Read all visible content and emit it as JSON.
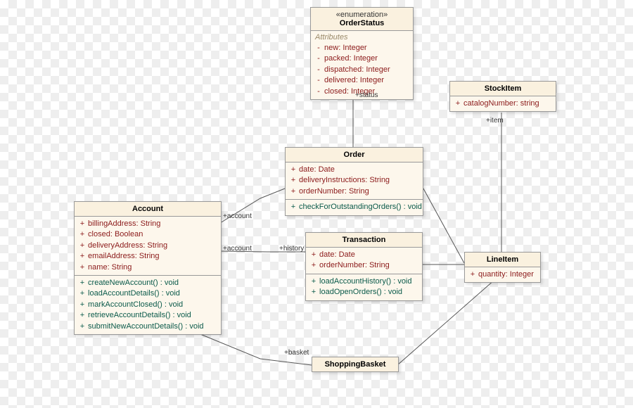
{
  "classes": {
    "orderStatus": {
      "stereotype": "«enumeration»",
      "name": "OrderStatus",
      "attrHeader": "Attributes",
      "attrs": [
        {
          "vis": "-",
          "text": "new: Integer"
        },
        {
          "vis": "-",
          "text": "packed: Integer"
        },
        {
          "vis": "-",
          "text": "dispatched: Integer"
        },
        {
          "vis": "-",
          "text": "delivered: Integer"
        },
        {
          "vis": "-",
          "text": "closed: Integer"
        }
      ]
    },
    "stockItem": {
      "name": "StockItem",
      "attrs": [
        {
          "vis": "+",
          "text": "catalogNumber: string"
        }
      ]
    },
    "order": {
      "name": "Order",
      "attrs": [
        {
          "vis": "+",
          "text": "date: Date"
        },
        {
          "vis": "+",
          "text": "deliveryInstructions: String"
        },
        {
          "vis": "+",
          "text": "orderNumber: String"
        }
      ],
      "ops": [
        {
          "vis": "+",
          "text": "checkForOutstandingOrders() : void"
        }
      ]
    },
    "account": {
      "name": "Account",
      "attrs": [
        {
          "vis": "+",
          "text": "billingAddress: String"
        },
        {
          "vis": "+",
          "text": "closed: Boolean"
        },
        {
          "vis": "+",
          "text": "deliveryAddress: String"
        },
        {
          "vis": "+",
          "text": "emailAddress: String"
        },
        {
          "vis": "+",
          "text": "name: String"
        }
      ],
      "ops": [
        {
          "vis": "+",
          "text": "createNewAccount() : void"
        },
        {
          "vis": "+",
          "text": "loadAccountDetails() : void"
        },
        {
          "vis": "+",
          "text": "markAccountClosed() : void"
        },
        {
          "vis": "+",
          "text": "retrieveAccountDetails() : void"
        },
        {
          "vis": "+",
          "text": "submitNewAccountDetails() : void"
        }
      ]
    },
    "transaction": {
      "name": "Transaction",
      "attrs": [
        {
          "vis": "+",
          "text": "date: Date"
        },
        {
          "vis": "+",
          "text": "orderNumber: String"
        }
      ],
      "ops": [
        {
          "vis": "+",
          "text": "loadAccountHistory() : void"
        },
        {
          "vis": "+",
          "text": "loadOpenOrders() : void"
        }
      ]
    },
    "lineItem": {
      "name": "LineItem",
      "attrs": [
        {
          "vis": "+",
          "text": "quantity: Integer"
        }
      ]
    },
    "shoppingBasket": {
      "name": "ShoppingBasket"
    }
  },
  "labels": {
    "status": "+status",
    "item": "+item",
    "account1": "+account",
    "account2": "+account",
    "history": "+history",
    "basket": "+basket"
  }
}
